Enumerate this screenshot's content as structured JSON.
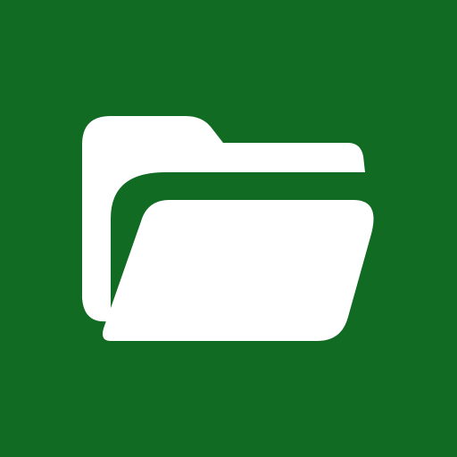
{
  "app_icon": {
    "icon": "open-folder-icon",
    "background_color": "#126b22",
    "foreground_color": "#ffffff"
  }
}
